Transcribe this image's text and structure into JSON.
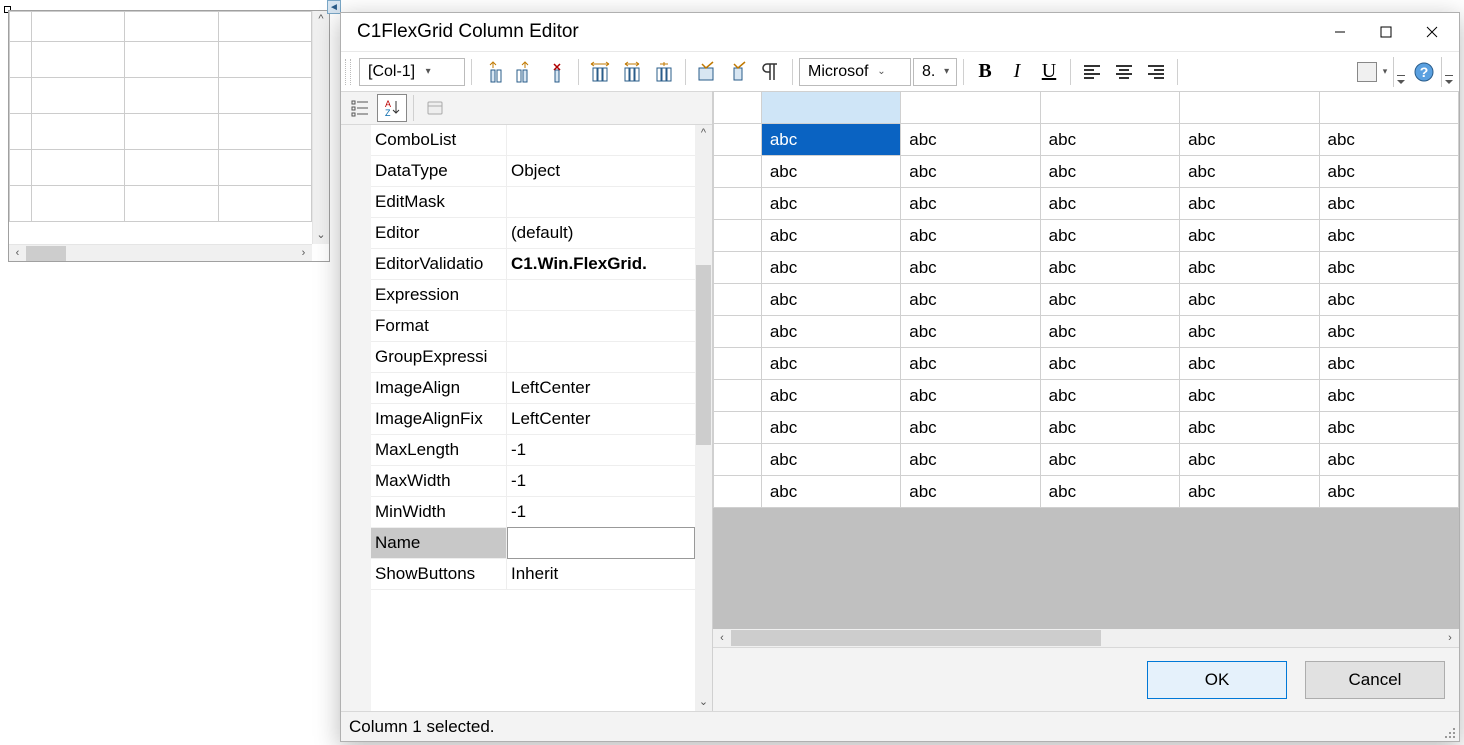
{
  "designer": {},
  "tab_arrow": "◄",
  "dialog": {
    "title": "C1FlexGrid Column Editor",
    "toolbar": {
      "column_selector": "[Col-1]",
      "font_name": "Microsof",
      "font_size": "8."
    },
    "properties": [
      {
        "name": "ComboList",
        "value": ""
      },
      {
        "name": "DataType",
        "value": "Object"
      },
      {
        "name": "EditMask",
        "value": ""
      },
      {
        "name": "Editor",
        "value": "(default)"
      },
      {
        "name": "EditorValidatio",
        "value": "C1.Win.FlexGrid.",
        "bold": true
      },
      {
        "name": "Expression",
        "value": ""
      },
      {
        "name": "Format",
        "value": ""
      },
      {
        "name": "GroupExpressi",
        "value": ""
      },
      {
        "name": "ImageAlign",
        "value": "LeftCenter"
      },
      {
        "name": "ImageAlignFix",
        "value": "LeftCenter"
      },
      {
        "name": "MaxLength",
        "value": "-1"
      },
      {
        "name": "MaxWidth",
        "value": "-1"
      },
      {
        "name": "MinWidth",
        "value": "-1"
      },
      {
        "name": "Name",
        "value": "",
        "selected": true
      },
      {
        "name": "ShowButtons",
        "value": "Inherit"
      }
    ],
    "grid": {
      "cell": "abc",
      "rows": 12,
      "cols": 5
    },
    "buttons": {
      "ok": "OK",
      "cancel": "Cancel"
    },
    "status": "Column 1 selected."
  }
}
